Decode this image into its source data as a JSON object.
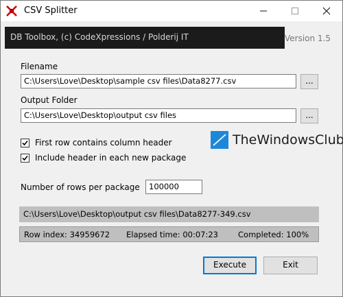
{
  "window": {
    "title": "CSV Splitter",
    "banner": "DB Toolbox, (c) CodeXpressions / Polderij IT",
    "version": "Version 1.5"
  },
  "form": {
    "filename_label": "Filename",
    "filename_value": "C:\\Users\\Love\\Desktop\\sample csv files\\Data8277.csv",
    "output_label": "Output Folder",
    "output_value": "C:\\Users\\Love\\Desktop\\output csv files",
    "browse_label": "...",
    "checkbox_header": {
      "label": "First row contains column header",
      "checked": true
    },
    "checkbox_include": {
      "label": "Include header in each new package",
      "checked": true
    },
    "rows_label": "Number of rows per package",
    "rows_value": "100000"
  },
  "watermark": "TheWindowsClub",
  "status": {
    "current_file": "C:\\Users\\Love\\Desktop\\output csv files\\Data8277-349.csv",
    "row_index": "Row index:  34959672",
    "elapsed": "Elapsed time:  00:07:23",
    "completed": "Completed:  100%"
  },
  "buttons": {
    "execute": "Execute",
    "exit": "Exit"
  },
  "colors": {
    "banner_bg": "#1b1b1b",
    "status_bg": "#bfbfbf",
    "default_button_border": "#0078d7",
    "watermark_blue": "#1e88d8"
  }
}
